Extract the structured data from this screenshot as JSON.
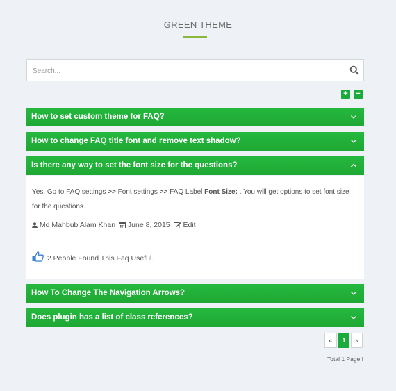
{
  "theme_title": "GREEN THEME",
  "search": {
    "placeholder": "Search..."
  },
  "controls": {
    "expand_label": "+",
    "collapse_label": "−"
  },
  "faqs": [
    {
      "question": "How to set custom theme for FAQ?",
      "expanded": false
    },
    {
      "question": "How to change FAQ title font and remove text shadow?",
      "expanded": false
    },
    {
      "question": "Is there any way to set the font size for the questions?",
      "expanded": true
    },
    {
      "question": "How To Change The Navigation Arrows?",
      "expanded": false
    },
    {
      "question": "Does plugin has a list of class references?",
      "expanded": false
    }
  ],
  "answer": {
    "text_part1": "Yes, Go to FAQ settings ",
    "sep1": ">>",
    "text_part2": " Font settings ",
    "sep2": ">>",
    "text_part3": " FAQ Label ",
    "bold_label": "Font Size:",
    "text_part4": " . You will get options to set font size for the questions.",
    "author": "Md Mahbub Alam Khan",
    "date": "June 8, 2015",
    "edit_label": "Edit",
    "useful_text": "2 People Found This Faq Useful."
  },
  "pagination": {
    "prev_label": "«",
    "current_page": "1",
    "next_label": "»",
    "total_text": "Total 1 Page !"
  },
  "colors": {
    "accent": "#1bab3c",
    "header_green": "#22b03a",
    "title_underline": "#8ab63a",
    "background": "#eef1f5",
    "thumb_blue": "#3b7fd1"
  }
}
